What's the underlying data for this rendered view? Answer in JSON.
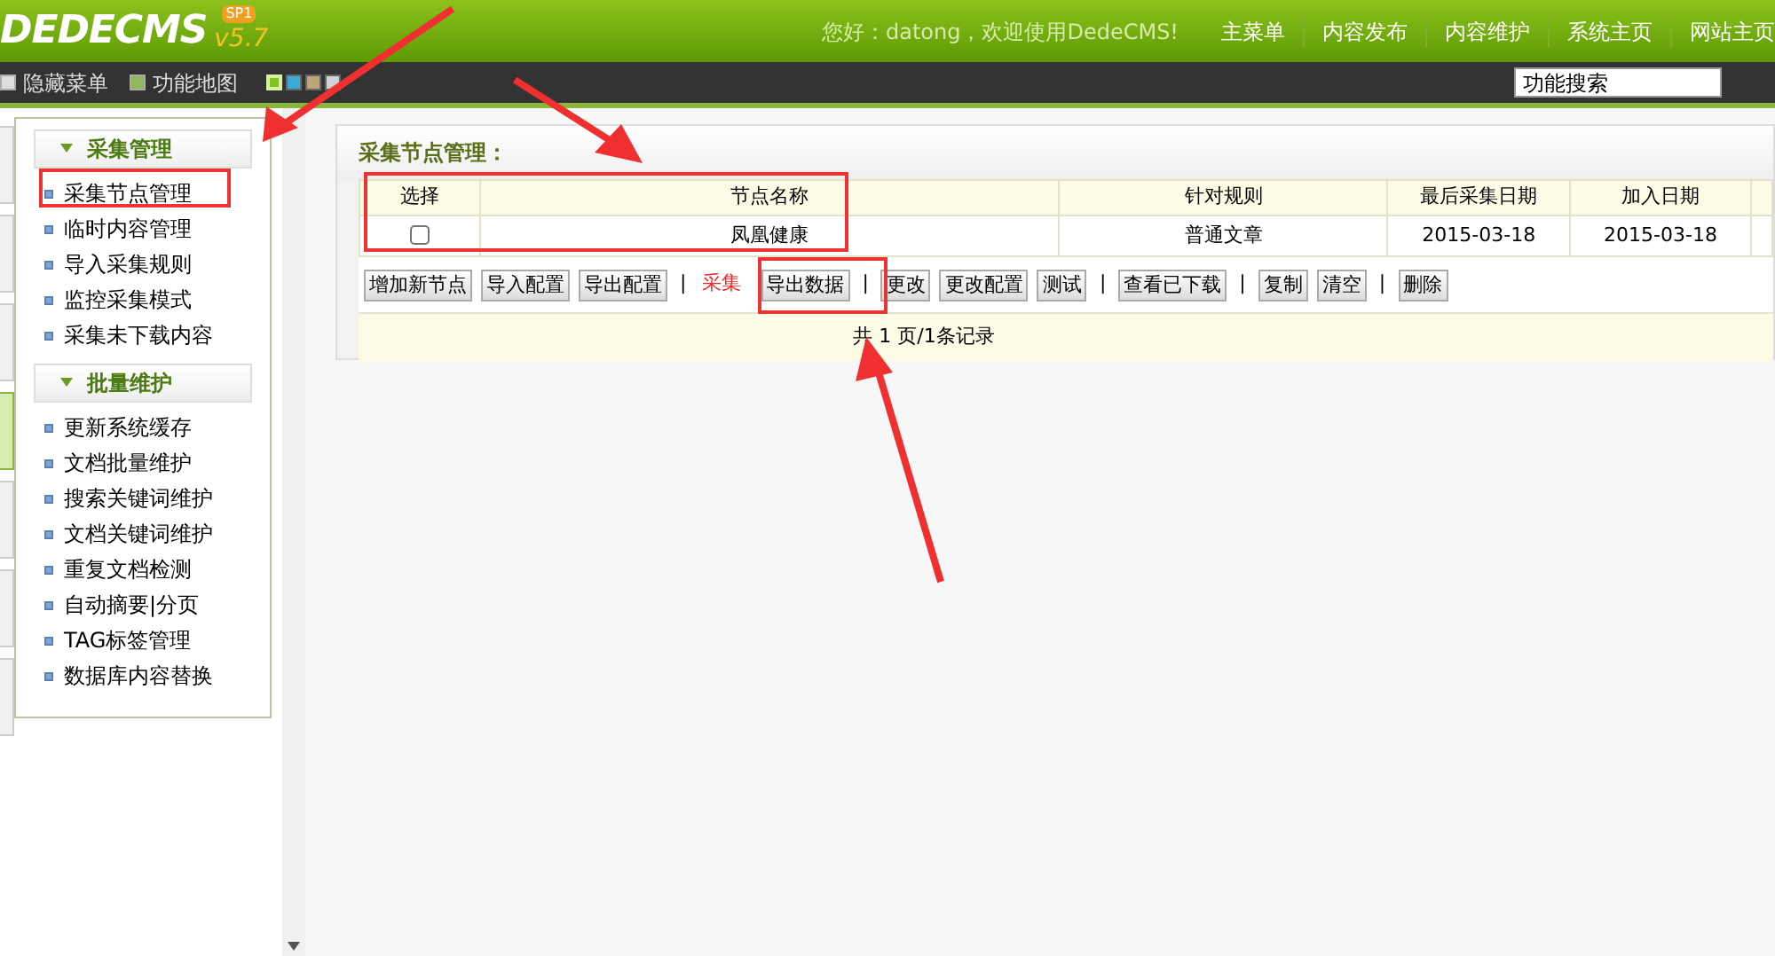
{
  "header": {
    "logo": "DEDECMS",
    "version": "v5.7",
    "badge": "SP1",
    "greeting": "您好：datong，欢迎使用DedeCMS!",
    "nav": [
      "主菜单",
      "内容发布",
      "内容维护",
      "系统主页",
      "网站主页"
    ]
  },
  "toolbar": {
    "links": [
      "隐藏菜单",
      "功能地图"
    ],
    "swatches": [
      {
        "color": "#7dc21e",
        "selected": true
      },
      {
        "color": "#3fa9d8",
        "selected": false
      },
      {
        "color": "#bba67c",
        "selected": false
      },
      {
        "color": "#cfd3d8",
        "selected": false
      }
    ],
    "search": {
      "value": "功能搜索"
    }
  },
  "side_tabs": [
    {
      "selected": false
    },
    {
      "selected": false
    },
    {
      "selected": false
    },
    {
      "selected": true
    },
    {
      "selected": false
    },
    {
      "selected": false
    },
    {
      "selected": false
    }
  ],
  "sidebar": {
    "sections": [
      {
        "title": "采集管理",
        "expanded": true,
        "items": [
          "采集节点管理",
          "临时内容管理",
          "导入采集规则",
          "监控采集模式",
          "采集未下载内容"
        ]
      },
      {
        "title": "批量维护",
        "expanded": true,
        "items": [
          "更新系统缓存",
          "文档批量维护",
          "搜索关键词维护",
          "文档关键词维护",
          "重复文档检测",
          "自动摘要|分页",
          "TAG标签管理",
          "数据库内容替换"
        ]
      }
    ]
  },
  "panel": {
    "title": "采集节点管理：",
    "table": {
      "columns": [
        "选择",
        "节点名称",
        "针对规则",
        "最后采集日期",
        "加入日期"
      ],
      "rows": [
        {
          "checked": false,
          "cells": [
            "",
            "凤凰健康",
            "普通文章",
            "2015-03-18",
            "2015-03-18"
          ]
        }
      ]
    },
    "actions": [
      {
        "kind": "button",
        "label": "增加新节点"
      },
      {
        "kind": "button",
        "label": "导入配置"
      },
      {
        "kind": "button",
        "label": "导出配置"
      },
      {
        "kind": "separator",
        "label": "|"
      },
      {
        "kind": "red",
        "label": "采集"
      },
      {
        "kind": "button",
        "label": "导出数据"
      },
      {
        "kind": "separator",
        "label": "|"
      },
      {
        "kind": "button",
        "label": "更改"
      },
      {
        "kind": "button",
        "label": "更改配置"
      },
      {
        "kind": "button",
        "label": "测试"
      },
      {
        "kind": "separator",
        "label": "|"
      },
      {
        "kind": "button",
        "label": "查看已下载"
      },
      {
        "kind": "separator",
        "label": "|"
      },
      {
        "kind": "button",
        "label": "复制"
      },
      {
        "kind": "button",
        "label": "清空"
      },
      {
        "kind": "separator",
        "label": "|"
      },
      {
        "kind": "button",
        "label": "删除"
      }
    ],
    "pagination": "共 1 页/1条记录"
  }
}
